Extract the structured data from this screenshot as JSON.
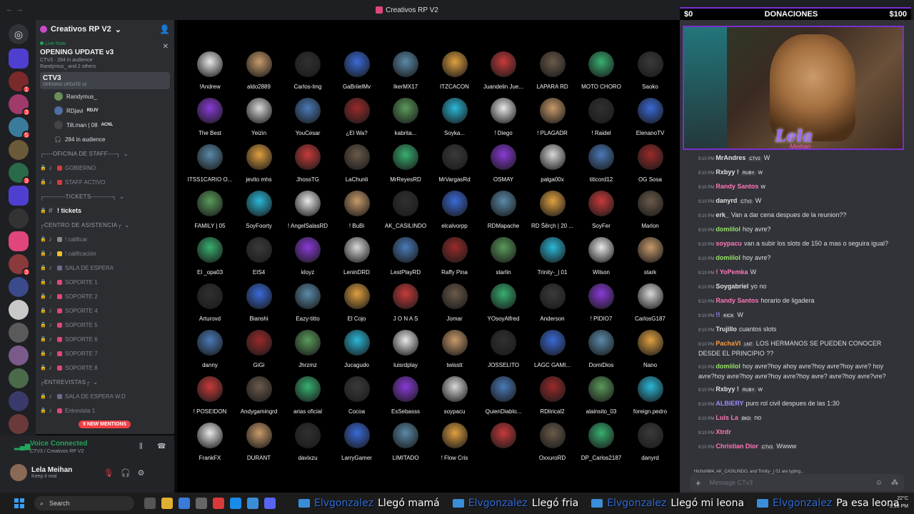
{
  "window": {
    "title": "Creativos RP V2",
    "nav_back": "←  →"
  },
  "guild": {
    "name": "Creativos RP V2"
  },
  "live_card": {
    "live_label": "Live Now",
    "title": "OPENING UPDATE v3",
    "line1": "CTV3 · 284 in audience",
    "line2": "Randymus_ and 2 others"
  },
  "channels": {
    "stage": {
      "name": "CTV3",
      "sub": "OPENING UPDATE v3"
    },
    "voice_users": [
      {
        "name": "Randymus_",
        "tag": "",
        "color": "#6b8f5a"
      },
      {
        "name": "RDjavi",
        "tag": "RDJV",
        "color": "#4f6fa0"
      },
      {
        "name": "Tilt.man | 08",
        "tag": "ACNL",
        "color": "#444"
      }
    ],
    "audience": "284 in audience",
    "items": [
      {
        "type": "cat",
        "label": "┌----OFICINA DE STAFF----┐"
      },
      {
        "type": "ch",
        "label": "GOBIERNO",
        "em": "#d43b3b"
      },
      {
        "type": "ch",
        "label": "STAFF ACTIVO",
        "em": "#d43b3b"
      },
      {
        "type": "cat",
        "label": "┌----------TICKETS----------┐"
      },
      {
        "type": "bold",
        "label": "! tickets"
      },
      {
        "type": "cat",
        "label": "┌CENTRO DE ASISTENCIA┌"
      },
      {
        "type": "ch",
        "label": "! calificar",
        "em": "#888"
      },
      {
        "type": "ch",
        "label": "! calificación",
        "em": "#f0c030"
      },
      {
        "type": "ch",
        "label": "SALA DE ESPERA",
        "em": "#6a6a8a"
      },
      {
        "type": "ch",
        "label": "SOPORTE 1",
        "em": "#e0457b"
      },
      {
        "type": "ch",
        "label": "SOPORTE 2",
        "em": "#e0457b"
      },
      {
        "type": "ch",
        "label": "SOPORTE 4",
        "em": "#e0457b"
      },
      {
        "type": "ch",
        "label": "SOPORTE 5",
        "em": "#e0457b"
      },
      {
        "type": "ch",
        "label": "SOPORTE 6",
        "em": "#e0457b"
      },
      {
        "type": "ch",
        "label": "SOPORTE 7",
        "em": "#e0457b"
      },
      {
        "type": "ch",
        "label": "SOPORTE 8",
        "em": "#e0457b"
      },
      {
        "type": "cat",
        "label": "┌ENTREVISTAS┌"
      },
      {
        "type": "ch",
        "label": "SALA DE ESPERA W.D",
        "em": "#6a6a8a"
      },
      {
        "type": "ch",
        "label": "Entrevista 1",
        "em": "#e0457b"
      }
    ],
    "mentions": "9 NEW MENTIONS"
  },
  "voice_panel": {
    "status": "Voice Connected",
    "where": "CTV3 / Creativos RP V2"
  },
  "user": {
    "name": "Lela Meihan",
    "status": "Keep it real"
  },
  "stage_grid": [
    [
      "!Andrew",
      "aldo2889",
      "Carlos-lmg",
      "GaBriielMv",
      "IkerMX17",
      "ITZCACON",
      "Juandelin Jue...",
      "LAPARA RD",
      "MOTO CHORO",
      "Saoko"
    ],
    [
      "The Best",
      "Yeizin",
      "YouCesar",
      "¿El Wa?",
      "kabrita...",
      "Soyka...",
      "! Diego",
      "! PLAGADR",
      "! Raidel",
      "ElenanoTV"
    ],
    [
      "ITSS1CARIO O...",
      "jevito mhs",
      "JhossTG",
      "LaChunli",
      "MrReyesRD",
      "MrVargasRd",
      "OSMAY",
      "palga00x",
      "titicord12",
      "OG Sosa"
    ],
    [
      "FAMILY | 05",
      "SoyFoorty",
      "! AngelSalasRD",
      "! BuBi",
      "AK_CASILINDO",
      "elcalvorpp",
      "RDMapache",
      "RD Šêrçh | 20 ...",
      "SoyFer",
      "Marlon"
    ],
    [
      "El _opa03",
      "EIS4",
      "kloyz",
      "LeninDRD",
      "LestPlayRD",
      "Raffy Pina",
      "starlin",
      "Trinity-_| 01",
      "Wilson",
      "stark"
    ],
    [
      "Arturovd",
      "Bianshi",
      "Eazy-titto",
      "El Cojo",
      "J O N A S",
      "Jomar",
      "YOsoyAlfred",
      "Anderson",
      "! PIDIO7",
      "CarlosG187"
    ],
    [
      "danny",
      "GiGi",
      "Jhrzmz",
      "Jucagudo",
      "luisrdplay",
      "twisstt",
      "JOSSELITO",
      "LAGC GAMI...",
      "DomiDios",
      "Nano"
    ],
    [
      "! POSEIDON",
      "Andygamingrd",
      "arias oficial",
      "Cocoa",
      "EsSebasss",
      "soypacu",
      "QuienDiablo...",
      "RDlirical2",
      "alainsito_03",
      "foreign.pedro"
    ],
    [
      "FrankFX",
      "DURANT",
      "davixzu",
      "LarryGamer",
      "LIMITADO",
      "! Flow Cris",
      "",
      "OxxuroRD",
      "DP_Carlos2187",
      "danyrd"
    ]
  ],
  "donations": {
    "left": "$0",
    "label": "DONACIONES",
    "right": "$100"
  },
  "overlay": {
    "brand": "Lela",
    "brand_sub": "Meihan"
  },
  "chat": [
    {
      "time": "9:10 PM",
      "author": "MrAndres",
      "tag": "CTV2",
      "color": "#e0e0e0",
      "text": "W"
    },
    {
      "time": "9:10 PM",
      "author": "Rxbyy !",
      "tag": "RUBY",
      "color": "#e0e0e0",
      "text": "w"
    },
    {
      "time": "9:10 PM",
      "author": "Randy Santos",
      "tag": "",
      "color": "#ff78b9",
      "text": "w"
    },
    {
      "time": "9:10 PM",
      "author": "danyrd",
      "tag": "CTV2",
      "color": "#e0e0e0",
      "text": "W"
    },
    {
      "time": "9:10 PM",
      "author": "erk_",
      "tag": "",
      "color": "#e0e0e0",
      "text": "Van a dar cena despues de la reunion??"
    },
    {
      "time": "9:10 PM",
      "author": "domiilol",
      "tag": "",
      "color": "#9be36c",
      "text": "hoy avre?"
    },
    {
      "time": "9:10 PM",
      "author": "soypacu",
      "tag": "",
      "color": "#ff78b9",
      "text": "van a subir los slots de 150 a mas o seguira igual?"
    },
    {
      "time": "9:10 PM",
      "author": "domiilol",
      "tag": "",
      "color": "#9be36c",
      "text": "hoy avre?"
    },
    {
      "time": "9:10 PM",
      "author": "! YoPemka",
      "tag": "",
      "color": "#ff78b9",
      "text": "W"
    },
    {
      "time": "9:10 PM",
      "author": "Soygabriel",
      "tag": "",
      "color": "#e0e0e0",
      "text": "yo no"
    },
    {
      "time": "9:10 PM",
      "author": "Randy Santos",
      "tag": "",
      "color": "#ff78b9",
      "text": "horario de ligadera"
    },
    {
      "time": "9:10 PM",
      "author": "!!",
      "tag": "KICK",
      "color": "#9a8cff",
      "text": "W"
    },
    {
      "time": "9:10 PM",
      "author": "Trujillo",
      "tag": "",
      "color": "#e0e0e0",
      "text": "cuantos slots"
    },
    {
      "time": "9:10 PM",
      "author": "PachaVI",
      "tag": "LNT",
      "color": "#ff9b3b",
      "text": "LOS HERMANOS SE PUEDEN CONOCER DESDE EL PRINCIPIO ??"
    },
    {
      "time": "9:10 PM",
      "author": "domiilol",
      "tag": "",
      "color": "#9be36c",
      "text": "hoy avre?hoy ahoy avre?hoy avre?hoy avre? hoy avre?hoy avre?hoy avre?hoy avre?hoy avre? avre?hoy avre?vre?"
    },
    {
      "time": "9:10 PM",
      "author": "Rxbyy !",
      "tag": "RUBY",
      "color": "#e0e0e0",
      "text": "w"
    },
    {
      "time": "9:10 PM",
      "author": "ALBIERY",
      "tag": "",
      "color": "#9a8cff",
      "text": "puro rol civil despues de las 1:30"
    },
    {
      "time": "9:10 PM",
      "author": "Luis La",
      "tag": "BKD",
      "color": "#ff78b9",
      "text": "no"
    },
    {
      "time": "9:10 PM",
      "author": "Xtrdr",
      "tag": "",
      "color": "#ff78b9",
      "text": ""
    },
    {
      "time": "9:10 PM",
      "author": "Christian Dior",
      "tag": "CTV2",
      "color": "#ff78b9",
      "text": "Wwww"
    }
  ],
  "typing": "HichoNM4, AK_CASILINDO, and Trinity-_| 01 are typing...",
  "composer": {
    "placeholder": "Message CTv3"
  },
  "taskbar": {
    "search": "Search",
    "clock": "9:10 PM",
    "date": "22°C"
  },
  "ticker": [
    {
      "nick": "Elvgonzalez",
      "text": "Llegó mamá"
    },
    {
      "nick": "Elvgonzalez",
      "text": "Llegó fria"
    },
    {
      "nick": "Elvgonzalez",
      "text": "Llegó mi leona"
    },
    {
      "nick": "Elvgonzalez",
      "text": "Pa esa leona"
    }
  ]
}
